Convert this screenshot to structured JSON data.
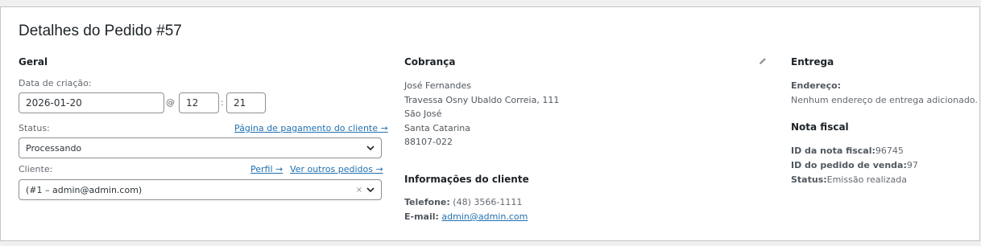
{
  "order": {
    "title": "Detalhes do Pedido #57"
  },
  "general": {
    "heading": "Geral",
    "date_label": "Data de criação:",
    "date_value": "2026-01-20",
    "at_sign": "@",
    "hour_value": "12",
    "time_sep": ":",
    "minute_value": "21",
    "status_label": "Status:",
    "payment_page_link": "Página de pagamento do cliente →",
    "status_value": "Processando",
    "customer_label": "Cliente:",
    "profile_link": "Perfil →",
    "other_orders_link": "Ver outros pedidos →",
    "customer_value": "(#1 – admin@admin.com)",
    "clear_symbol": "×"
  },
  "billing": {
    "heading": "Cobrança",
    "address_lines": [
      "José Fernandes",
      "Travessa Osny Ubaldo Correia, 111",
      "São José",
      "Santa Catarina",
      "88107-022"
    ],
    "customer_info_heading": "Informações do cliente",
    "phone_label": "Telefone:",
    "phone_value": "(48) 3566-1111",
    "email_label": "E-mail:",
    "email_value": "admin@admin.com"
  },
  "shipping": {
    "heading": "Entrega",
    "address_label": "Endereço:",
    "address_value": "Nenhum endereço de entrega adicionado."
  },
  "invoice": {
    "heading": "Nota fiscal",
    "invoice_id_label": "ID da nota fiscal:",
    "invoice_id_value": "96745",
    "sales_order_label": "ID do pedido de venda:",
    "sales_order_value": "97",
    "status_label": "Status:",
    "status_value": "Emissão realizada"
  },
  "icons": {
    "edit": "pencil-icon",
    "dropdown": "chevron-down-icon",
    "clear": "close-icon"
  },
  "colors": {
    "link": "#2271b1",
    "border": "#8c8f94",
    "heading": "#1d2327"
  }
}
